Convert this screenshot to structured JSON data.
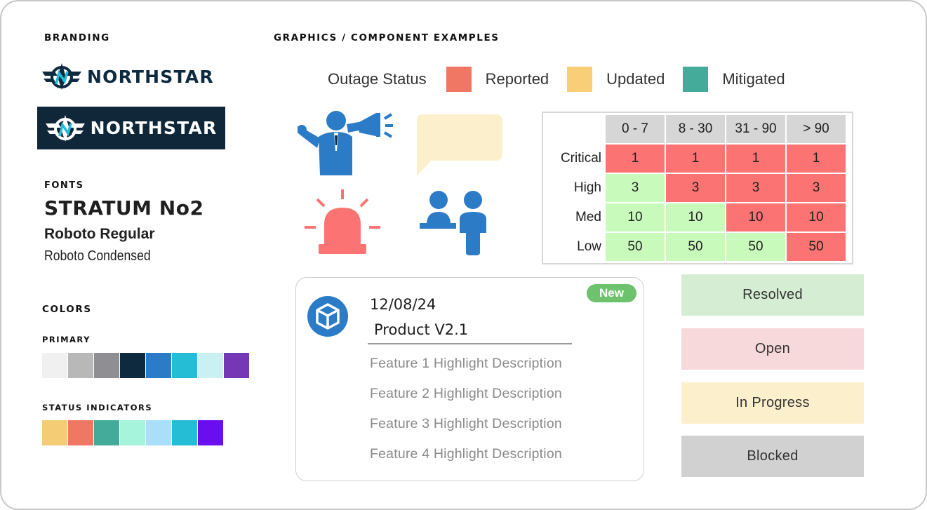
{
  "branding": {
    "heading": "BRANDING",
    "logo_text": "NORTHSTAR",
    "logo_text_dark": "NORTHSTAR"
  },
  "fonts": {
    "heading": "FONTS",
    "font1": "STRATUM No2",
    "font2": "Roboto Regular",
    "font3": "Roboto Condensed"
  },
  "colors": {
    "heading": "COLORS",
    "primary_heading": "PRIMARY",
    "primary": [
      "#f0f0f0",
      "#b8b8b8",
      "#8e8e93",
      "#0e2a3f",
      "#2b7bc6",
      "#25bcd6",
      "#c9f0f3",
      "#7537b3"
    ],
    "status_heading": "STATUS INDICATORS",
    "status": [
      "#f5cc76",
      "#f17765",
      "#44aa99",
      "#a7f4dc",
      "#aadffa",
      "#25bcd6",
      "#6a0ef0"
    ]
  },
  "graphics": {
    "heading": "GRAPHICS / COMPONENT EXAMPLES",
    "legend": {
      "label": "Outage Status",
      "items": [
        {
          "label": "Reported",
          "color": "#f17765"
        },
        {
          "label": "Updated",
          "color": "#f8cf76"
        },
        {
          "label": "Mitigated",
          "color": "#44aa99"
        }
      ]
    },
    "icons": [
      "speaker-megaphone-icon",
      "speech-bubble-icon",
      "alarm-siren-icon",
      "people-meeting-icon"
    ]
  },
  "matrix": {
    "columns": [
      "0 - 7",
      "8 - 30",
      "31 - 90",
      "> 90"
    ],
    "rows": [
      {
        "label": "Critical",
        "values": [
          "1",
          "1",
          "1",
          "1"
        ],
        "status": [
          "red",
          "red",
          "red",
          "red"
        ]
      },
      {
        "label": "High",
        "values": [
          "3",
          "3",
          "3",
          "3"
        ],
        "status": [
          "green",
          "red",
          "red",
          "red"
        ]
      },
      {
        "label": "Med",
        "values": [
          "10",
          "10",
          "10",
          "10"
        ],
        "status": [
          "green",
          "green",
          "red",
          "red"
        ]
      },
      {
        "label": "Low",
        "values": [
          "50",
          "50",
          "50",
          "50"
        ],
        "status": [
          "green",
          "green",
          "green",
          "red"
        ]
      }
    ]
  },
  "release_card": {
    "badge": "New",
    "date": "12/08/24",
    "product": "Product V2.1",
    "features": [
      "Feature 1 Highlight Description",
      "Feature 2 Highlight Description",
      "Feature 3 Highlight Description",
      "Feature 4 Highlight Description"
    ]
  },
  "status_buttons": [
    {
      "label": "Resolved",
      "color": "#d5eed3"
    },
    {
      "label": "Open",
      "color": "#f7d8db"
    },
    {
      "label": "In Progress",
      "color": "#fcefcc"
    },
    {
      "label": "Blocked",
      "color": "#d1d1d1"
    }
  ]
}
